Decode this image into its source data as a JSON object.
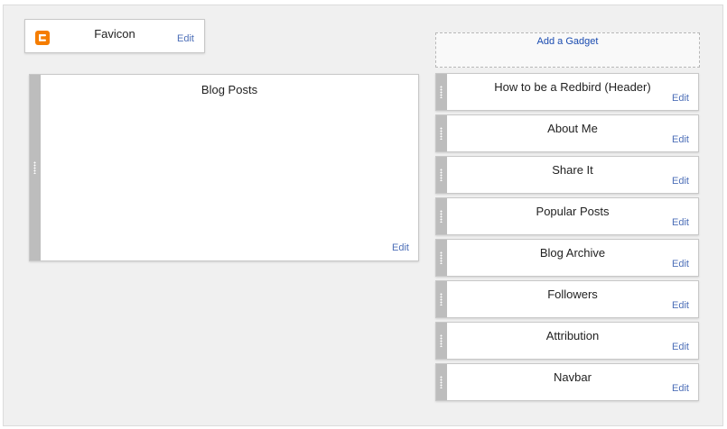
{
  "favicon": {
    "title": "Favicon",
    "edit_label": "Edit",
    "icon": "blogger-icon",
    "icon_color": "#f57d00"
  },
  "main": {
    "title": "Blog Posts",
    "edit_label": "Edit"
  },
  "sidebar": {
    "add_gadget_label": "Add a Gadget",
    "gadgets": [
      {
        "title": "How to be a Redbird (Header)",
        "edit_label": "Edit"
      },
      {
        "title": "About Me",
        "edit_label": "Edit"
      },
      {
        "title": "Share It",
        "edit_label": "Edit"
      },
      {
        "title": "Popular Posts",
        "edit_label": "Edit"
      },
      {
        "title": "Blog Archive",
        "edit_label": "Edit"
      },
      {
        "title": "Followers",
        "edit_label": "Edit"
      },
      {
        "title": "Attribution",
        "edit_label": "Edit"
      },
      {
        "title": "Navbar",
        "edit_label": "Edit"
      }
    ]
  },
  "colors": {
    "link": "#4d6fb8",
    "add_gadget_link": "#1a4bb0",
    "handle": "#bdbdbd",
    "background": "#f0f0f0"
  }
}
